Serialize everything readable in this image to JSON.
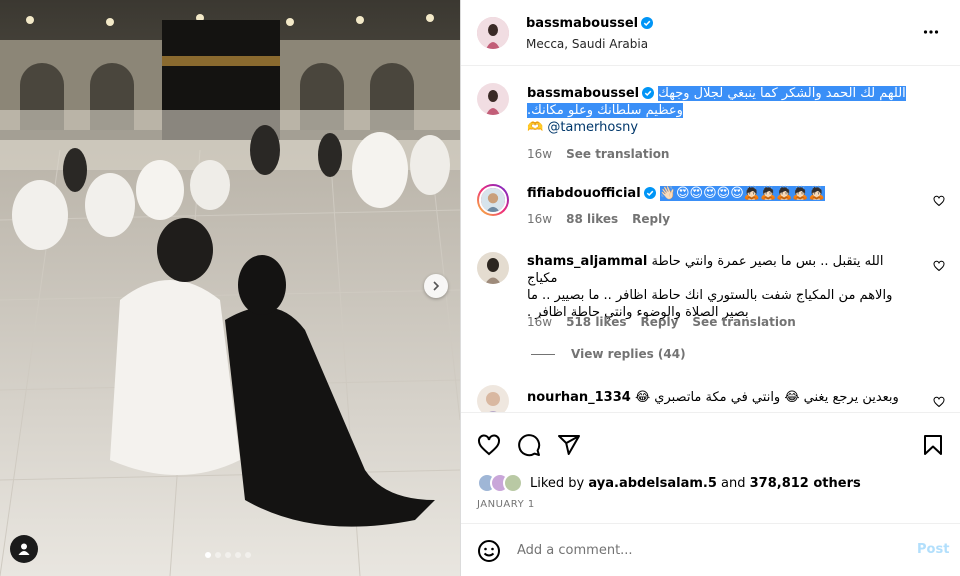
{
  "post": {
    "author": "bassmaboussel",
    "location": "Mecca, Saudi Arabia",
    "verified": true
  },
  "caption": {
    "username": "bassmaboussel",
    "line1": "اللهم لك الحمد والشكر كما ينبغي لجلال وجهك",
    "line2": "وعظيم سلطانك وعلو مكانك.",
    "mention_prefix": "🫶",
    "mention": "@tamerhosny",
    "time": "16w",
    "see_translation": "See translation"
  },
  "comments": [
    {
      "username": "fifiabdouofficial",
      "text": "👋🏻😍😍😍😍😍🙇🏻🙇🏻🙇🏻🙇🏻🙇🏻",
      "time": "16w",
      "likes": "88 likes",
      "reply": "Reply"
    },
    {
      "username": "shams_aljammal",
      "line1": "الله يتقبل .. بس ما بصير عمرة وانتي حاطة مكياج",
      "line2": "والاهم من المكياج شفت بالستوري انك حاطة اظافر .. ما بصيير .. ما",
      "line3": "بصير الصلاة والوضوء وانتي حاطة اظافر .",
      "time": "16w",
      "likes": "518 likes",
      "reply": "Reply",
      "see_translation": "See translation",
      "view_replies": "View replies (44)"
    },
    {
      "username": "nourhan_1334",
      "text": "وبعدين يرجع يغني 😂 وانتي في مكة ماتصبري 😂"
    }
  ],
  "likes": {
    "prefix": "Liked by",
    "user": "aya.abdelsalam.5",
    "and": "and",
    "others": "378,812 others"
  },
  "date": "JANUARY 1",
  "add_comment": {
    "placeholder": "Add a comment...",
    "post_label": "Post"
  },
  "carousel": {
    "slides": 5,
    "active": 1
  },
  "colors": {
    "verified": "#0095f6",
    "highlight": "#3a8ff7",
    "secondary_text": "#737373",
    "post_button": "#b2dffc"
  },
  "icons": [
    "verified-icon",
    "more-icon",
    "heart-icon",
    "comment-icon",
    "share-icon",
    "save-icon",
    "emoji-icon",
    "chevron-right-icon",
    "user-tag-icon"
  ]
}
